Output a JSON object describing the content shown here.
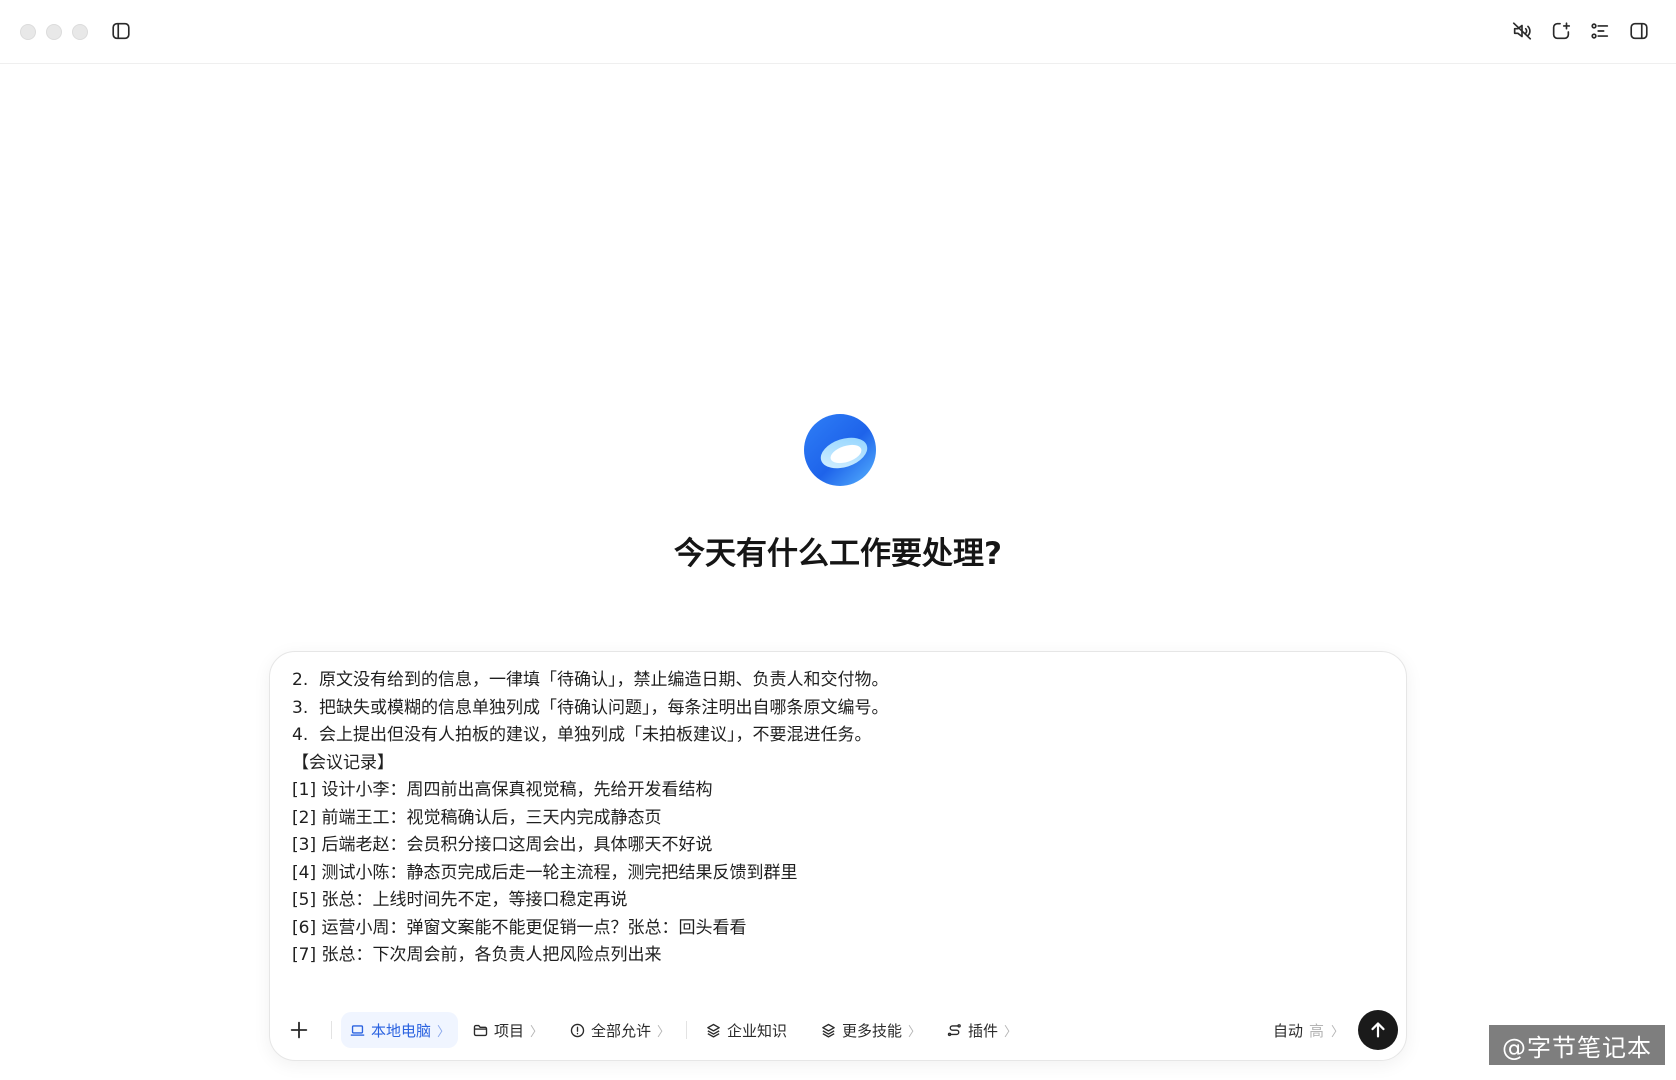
{
  "window": {
    "toolbar_icons": [
      "sidebar-toggle-icon",
      "mute-icon",
      "new-chat-icon",
      "task-list-icon",
      "right-panel-icon"
    ]
  },
  "main": {
    "greeting": "今天有什么工作要处理?"
  },
  "composer": {
    "lines": [
      "2.  原文没有给到的信息，一律填「待确认」，禁止编造日期、负责人和交付物。",
      "3.  把缺失或模糊的信息单独列成「待确认问题」，每条注明出自哪条原文编号。",
      "4.  会上提出但没有人拍板的建议，单独列成「未拍板建议」，不要混进任务。",
      "【会议记录】",
      "[1] 设计小李：周四前出高保真视觉稿，先给开发看结构",
      "[2] 前端王工：视觉稿确认后，三天内完成静态页",
      "[3] 后端老赵：会员积分接口这周会出，具体哪天不好说",
      "[4] 测试小陈：静态页完成后走一轮主流程，测完把结果反馈到群里",
      "[5] 张总：上线时间先不定，等接口稳定再说",
      "[6] 运营小周：弹窗文案能不能更促销一点？张总：回头看看",
      "[7] 张总：下次周会前，各负责人把风险点列出来"
    ],
    "toolbar": {
      "local_computer": "本地电脑",
      "project": "项目",
      "permission": "全部允许",
      "enterprise_knowledge": "企业知识",
      "more_skills": "更多技能",
      "plugins": "插件",
      "mode": "自动",
      "level": "高",
      "chevron": "〉"
    },
    "accent_color": "#2b63e0"
  },
  "watermark": {
    "text": "@字节笔记本"
  }
}
